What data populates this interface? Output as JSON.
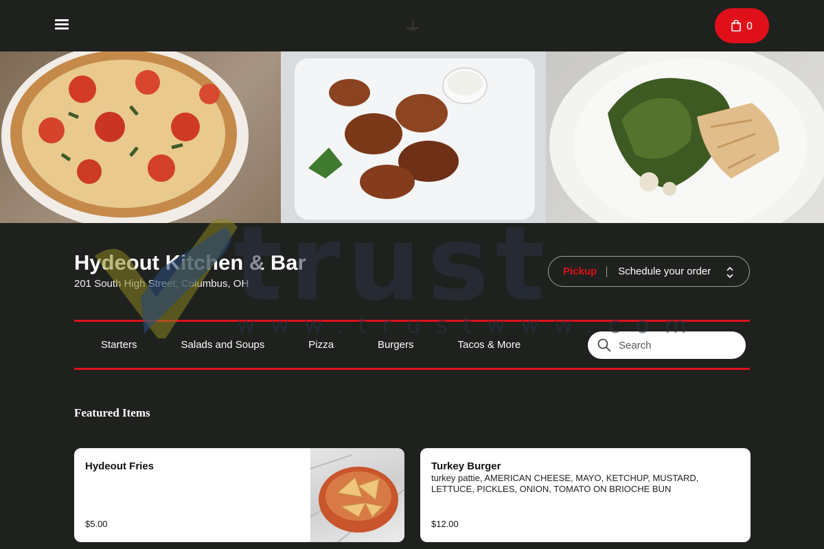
{
  "header": {
    "cart_count": "0"
  },
  "restaurant": {
    "name": "Hydeout Kitchen & Bar",
    "address": "201 South High Street, Columbus, OH"
  },
  "order": {
    "mode": "Pickup",
    "schedule": "Schedule your order"
  },
  "categories": [
    "Starters",
    "Salads and Soups",
    "Pizza",
    "Burgers",
    "Tacos & More"
  ],
  "search": {
    "placeholder": "Search"
  },
  "featured": {
    "title": "Featured Items",
    "items": [
      {
        "name": "Hydeout Fries",
        "description": "",
        "price": "$5.00"
      },
      {
        "name": "Turkey Burger",
        "description": "turkey pattie, AMERICAN CHEESE, MAYO, KETCHUP, MUSTARD, LETTUCE, PICKLES, ONION, TOMATO ON BRIOCHE BUN",
        "price": "$12.00"
      }
    ]
  },
  "watermark": {
    "text": "trust",
    "url": "www.trustwww.com"
  },
  "colors": {
    "accent": "#e0101b",
    "background": "#1e211d"
  }
}
